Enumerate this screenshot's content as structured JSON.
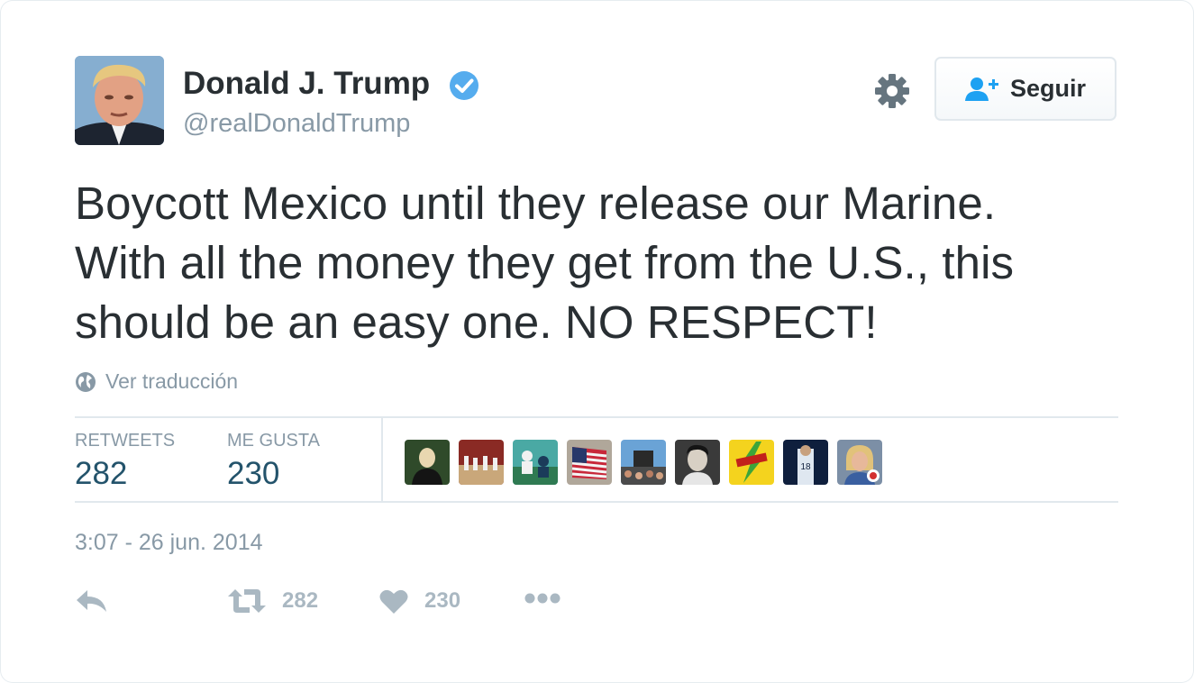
{
  "author": {
    "name": "Donald J. Trump",
    "handle": "@realDonaldTrump",
    "verified": true
  },
  "follow_button": {
    "label": "Seguir"
  },
  "tweet": {
    "text": "Boycott Mexico until they release our Marine.\nWith all the money they get from the U.S., this\nshould be an easy one. NO RESPECT!",
    "translate_label": "Ver traducción",
    "timestamp": "3:07 - 26 jun. 2014"
  },
  "stats": {
    "retweets_label": "RETWEETS",
    "retweets_count": "282",
    "likes_label": "ME GUSTA",
    "likes_count": "230",
    "liker_avatars": 9
  },
  "actions": {
    "retweet_count": "282",
    "like_count": "230"
  },
  "colors": {
    "text": "#292f33",
    "muted": "#8899a6",
    "verified": "#55acee",
    "count": "#23536b",
    "icon": "#aab8c2"
  },
  "icons": [
    "verified-icon",
    "gear-icon",
    "add-user-icon",
    "globe-icon",
    "reply-icon",
    "retweet-icon",
    "heart-icon",
    "more-icon"
  ]
}
